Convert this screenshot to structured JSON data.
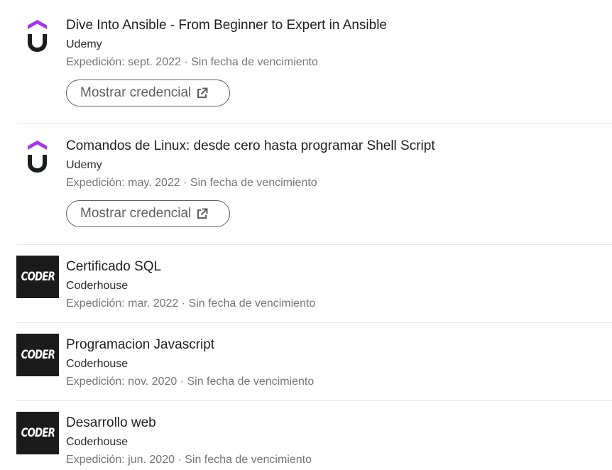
{
  "certifications": [
    {
      "title": "Dive Into Ansible - From Beginner to Expert in Ansible",
      "issuer": "Udemy",
      "meta": "Expedición: sept. 2022 · Sin fecha de vencimiento",
      "button_label": "Mostrar credencial",
      "logo_type": "udemy-logo"
    },
    {
      "title": "Comandos de Linux: desde cero hasta programar Shell Script",
      "issuer": "Udemy",
      "meta": "Expedición: may. 2022 · Sin fecha de vencimiento",
      "button_label": "Mostrar credencial",
      "logo_type": "udemy-logo"
    },
    {
      "title": "Certificado SQL",
      "issuer": "Coderhouse",
      "meta": "Expedición: mar. 2022 · Sin fecha de vencimiento",
      "logo_type": "coderhouse-logo",
      "logo_text": "CODER"
    },
    {
      "title": "Programacion Javascript",
      "issuer": "Coderhouse",
      "meta": "Expedición: nov. 2020 · Sin fecha de vencimiento",
      "logo_type": "coderhouse-logo",
      "logo_text": "CODER"
    },
    {
      "title": "Desarrollo web",
      "issuer": "Coderhouse",
      "meta": "Expedición: jun. 2020 · Sin fecha de vencimiento",
      "logo_type": "coderhouse-logo",
      "logo_text": "CODER"
    }
  ],
  "colors": {
    "udemy_purple": "#a435f0",
    "udemy_black": "#1c1d1f",
    "coder_bg": "#1b1b1b"
  }
}
